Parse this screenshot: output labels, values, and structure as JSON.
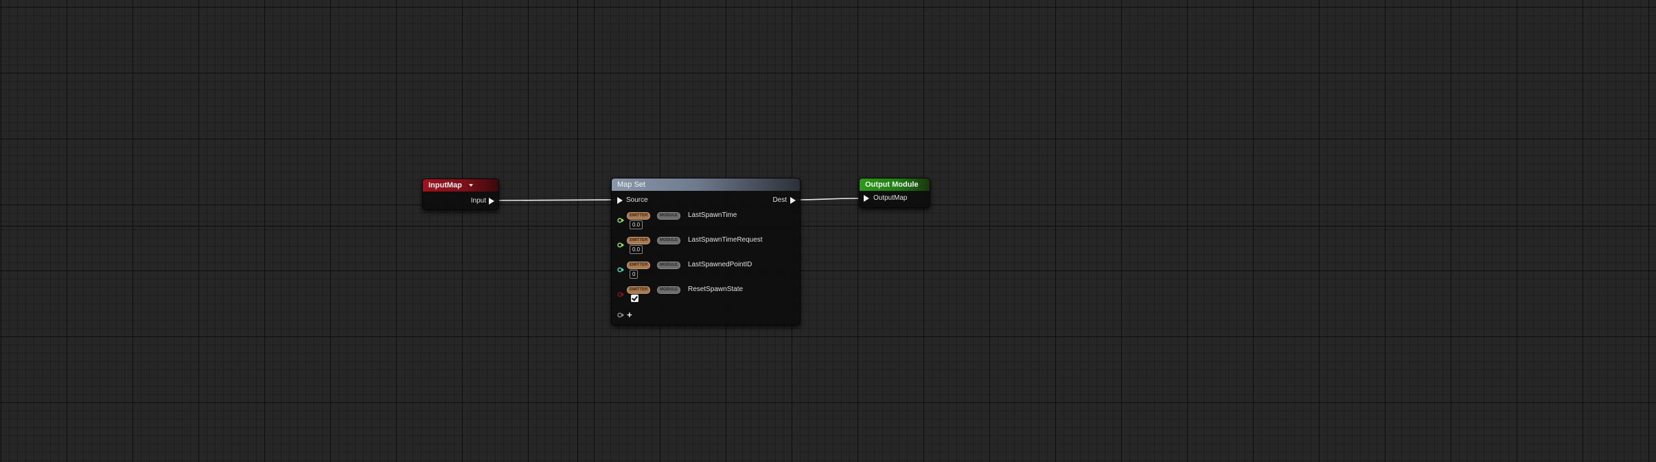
{
  "colors": {
    "float_pin": "#9ae05a",
    "int_pin": "#4fd3b8",
    "bool_pin": "#8a1616",
    "add_pin": "#8a8a8a",
    "wire": "#e8e8e8"
  },
  "input_map_node": {
    "title": "InputMap",
    "output_pin_label": "Input"
  },
  "map_set_node": {
    "title": "Map Set",
    "source_label": "Source",
    "dest_label": "Dest",
    "params": [
      {
        "namespace": "EMITTER",
        "module": "MODULE",
        "name": "LastSpawnTime",
        "value": "0.0",
        "pin_type": "float"
      },
      {
        "namespace": "EMITTER",
        "module": "MODULE",
        "name": "LastSpawnTimeRequest",
        "value": "0.0",
        "pin_type": "float"
      },
      {
        "namespace": "EMITTER",
        "module": "MODULE",
        "name": "LastSpawnedPointID",
        "value": "0",
        "pin_type": "int"
      },
      {
        "namespace": "EMITTER",
        "module": "MODULE",
        "name": "ResetSpawnState",
        "value": true,
        "pin_type": "bool"
      }
    ],
    "add_pin_icon": "plus-icon"
  },
  "output_module_node": {
    "title": "Output Module",
    "input_pin_label": "OutputMap"
  }
}
